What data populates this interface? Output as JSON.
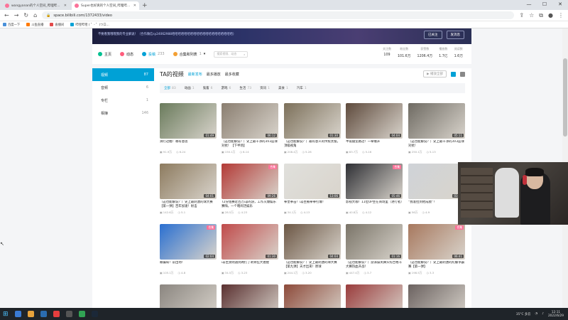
{
  "browser": {
    "tabs": [
      {
        "label": "wangyanan的个人空间_哔哩哔...",
        "active": false
      },
      {
        "label": "Super也好爽的个人空间_哔哩哔...",
        "active": true
      }
    ],
    "url": "space.bilibili.com/1372433/video",
    "bookmarks": [
      "百度一下",
      "斗鱼直播",
      "直播间",
      "哔哩哔哩 ( ゜- ゜)つロ..."
    ]
  },
  "banner": {
    "text": "不要看我哦哦我的专业解说！（合作微信sy24062988哈哈哈哈哈哈哈哈哈哈哈哈哈哈哈哈哈哈哈哈）",
    "follow_label": "已关注",
    "message_label": "发消息"
  },
  "nav": {
    "items": [
      {
        "label": "主页",
        "count": "",
        "icon": "home-icon",
        "color": "#00c091"
      },
      {
        "label": "动态",
        "count": "",
        "icon": "dynamic-icon",
        "color": "#ff5c7c"
      },
      {
        "label": "投稿",
        "count": "233",
        "icon": "upload-icon",
        "color": "#00a1d6"
      },
      {
        "label": "合集和列表",
        "count": "1",
        "icon": "collection-icon",
        "color": "#f3a034"
      }
    ],
    "search_placeholder": "搜索视频、动态",
    "stats": [
      {
        "label": "关注数",
        "value": "109"
      },
      {
        "label": "粉丝数",
        "value": "101.6万"
      },
      {
        "label": "获赞数",
        "value": "1206.4万"
      },
      {
        "label": "播放数",
        "value": "1.7亿"
      },
      {
        "label": "阅读数",
        "value": "1.6万"
      }
    ]
  },
  "leftnav": [
    {
      "label": "视频",
      "count": "87",
      "active": true
    },
    {
      "label": "音频",
      "count": "6",
      "active": false
    },
    {
      "label": "专栏",
      "count": "1",
      "active": false
    },
    {
      "label": "相簿",
      "count": "146",
      "active": false
    }
  ],
  "main": {
    "title": "TA的视频",
    "sorts": [
      {
        "label": "最新发布",
        "active": true
      },
      {
        "label": "最多播放",
        "active": false
      },
      {
        "label": "最多收藏",
        "active": false
      }
    ],
    "play_all_label": "播放全部",
    "filters": [
      {
        "label": "全部",
        "count": "83",
        "active": true
      },
      {
        "label": "动画",
        "count": "1",
        "active": false
      },
      {
        "label": "鬼畜",
        "count": "6",
        "active": false
      },
      {
        "label": "游戏",
        "count": "6",
        "active": false
      },
      {
        "label": "生活",
        "count": "73",
        "active": false
      },
      {
        "label": "资讯",
        "count": "1",
        "active": false
      },
      {
        "label": "美食",
        "count": "1",
        "active": false
      },
      {
        "label": "汽车",
        "count": "1",
        "active": false
      }
    ]
  },
  "videos": [
    {
      "title": "滑行过瘾！哪有意思",
      "plays": "91.9万",
      "date": "6-24",
      "duration": "01:49",
      "color": "#6a7b5c",
      "badge": ""
    },
    {
      "title": "（这也能解说？）史上最干净的3V3篮球对抗！【下半场】",
      "plays": "150.1万",
      "date": "6-14",
      "duration": "06:12",
      "color": "#8a7e70",
      "badge": ""
    },
    {
      "title": "（这也能解说？）最有意义的传统太极，顶级视角",
      "plays": "208.4万",
      "date": "5-28",
      "duration": "01:30",
      "color": "#7c705a",
      "badge": ""
    },
    {
      "title": "半夜寝室路过！一拳爆开",
      "plays": "83.7万",
      "date": "5-16",
      "duration": "04:04",
      "color": "#5e4a3c",
      "badge": ""
    },
    {
      "title": "（这也能解说？）史上最干净的3V3篮球对抗！",
      "plays": "250.1万",
      "date": "5-13",
      "duration": "05:11",
      "color": "#6e6a62",
      "badge": ""
    },
    {
      "title": "（这也能解说？）史上最刺激的球大赛【第一弹】百年加速！射击",
      "plays": "142.6万",
      "date": "5-1",
      "duration": "04:01",
      "color": "#8d7b5f",
      "badge": ""
    },
    {
      "title": "T2分组赛近百万up的游，工作火爆娱乐赛嗨，一个瞎闹活娱乐",
      "plays": "28.5万",
      "date": "4-23",
      "duration": "09:26",
      "color": "#b33a36",
      "badge": "合集"
    },
    {
      "title": "拳皇拳击！up主被拳拳打爆！",
      "plays": "34.1万",
      "date": "4-13",
      "duration": "13:06",
      "color": "#e0e0dc",
      "badge": ""
    },
    {
      "title": "影视大咖！11位UP主在商场里（进行者）",
      "plays": "40.8万",
      "date": "4-12",
      "duration": "05:46",
      "color": "#2e2f34",
      "badge": "合集"
    },
    {
      "title": "“我准拉到他成绩”！",
      "plays": "56万",
      "date": "4-9",
      "duration": "03:17",
      "color": "#cfd3d8",
      "badge": ""
    },
    {
      "title": "被骗局！前出场！",
      "plays": "105.1万",
      "date": "4-8",
      "duration": "02:04",
      "color": "#2a6fd0",
      "badge": "合集"
    },
    {
      "title": "up主莫明遇到两打了刺骨狂大猩猩",
      "plays": "34.5万",
      "date": "3-23",
      "duration": "01:30",
      "color": "#c04a4a",
      "badge": ""
    },
    {
      "title": "（这也能解说？）史上最刺激的球大赛【第九弹】天才出来！原球",
      "plays": "244.1万",
      "date": "3-20",
      "duration": "04:04",
      "color": "#6b5644",
      "badge": ""
    },
    {
      "title": "（这也能解说？）游泳操英舞头综合格斗大赛热血开战！",
      "plays": "447.4万",
      "date": "3-7",
      "duration": "01:16",
      "color": "#7a7468",
      "badge": ""
    },
    {
      "title": "（这也能解说？）史上最刺激的陀螺争霸赛【第一弹】",
      "plays": "198.5万",
      "date": "3-3",
      "duration": "06:41",
      "color": "#a7785e",
      "badge": "合集"
    },
    {
      "title": "",
      "plays": "",
      "date": "",
      "duration": "",
      "color": "#8b8680",
      "badge": ""
    },
    {
      "title": "",
      "plays": "",
      "date": "",
      "duration": "",
      "color": "#5a3030",
      "badge": ""
    },
    {
      "title": "",
      "plays": "",
      "date": "",
      "duration": "",
      "color": "#8d4a3a",
      "badge": ""
    },
    {
      "title": "",
      "plays": "",
      "date": "",
      "duration": "",
      "color": "#9a3c3c",
      "badge": ""
    },
    {
      "title": "",
      "plays": "",
      "date": "",
      "duration": "",
      "color": "#6b6260",
      "badge": ""
    }
  ],
  "taskbar": {
    "weather": "35°C 多云",
    "time": "12:11",
    "date": "2022/6/29"
  }
}
